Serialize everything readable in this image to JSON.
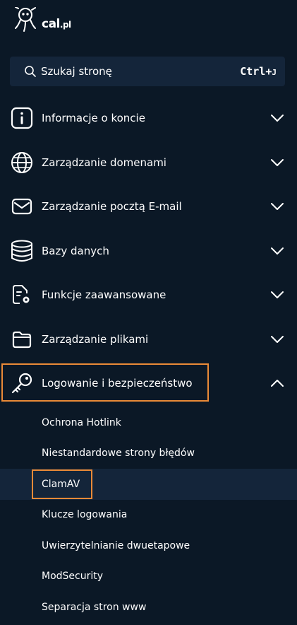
{
  "brand": {
    "logo_main": "cal",
    "logo_suffix": ".pl"
  },
  "search": {
    "placeholder": "Szukaj stronę",
    "shortcut_main": "Ctrl+",
    "shortcut_key": "J"
  },
  "menu": [
    {
      "label": "Informacje o koncie",
      "icon": "info-icon",
      "expanded": false
    },
    {
      "label": "Zarządzanie domenami",
      "icon": "globe-icon",
      "expanded": false
    },
    {
      "label": "Zarządzanie pocztą E-mail",
      "icon": "mail-icon",
      "expanded": false
    },
    {
      "label": "Bazy danych",
      "icon": "database-icon",
      "expanded": false
    },
    {
      "label": "Funkcje zaawansowane",
      "icon": "file-settings-icon",
      "expanded": false
    },
    {
      "label": "Zarządzanie plikami",
      "icon": "folder-icon",
      "expanded": false
    },
    {
      "label": "Logowanie i bezpieczeństwo",
      "icon": "key-icon",
      "expanded": true
    }
  ],
  "submenu": [
    {
      "label": "Ochrona Hotlink"
    },
    {
      "label": "Niestandardowe strony błędów"
    },
    {
      "label": "ClamAV",
      "selected": true
    },
    {
      "label": "Klucze logowania"
    },
    {
      "label": "Uwierzytelnianie dwuetapowe"
    },
    {
      "label": "ModSecurity"
    },
    {
      "label": "Separacja stron www"
    }
  ],
  "colors": {
    "background": "#0b1826",
    "highlight": "#14253a",
    "accent_outline": "#ea8a37"
  }
}
